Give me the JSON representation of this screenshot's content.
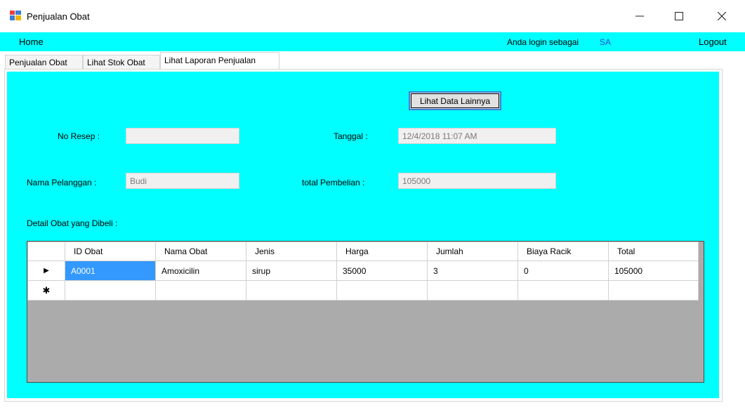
{
  "window": {
    "title": "Penjualan Obat",
    "minimize_icon": "minimize-icon",
    "maximize_icon": "maximize-icon",
    "close_icon": "close-icon"
  },
  "menubar": {
    "home": "Home",
    "login_label": "Anda login sebagai",
    "login_user": "SA",
    "logout": "Logout"
  },
  "tabs": [
    {
      "label": "Penjualan Obat"
    },
    {
      "label": "Lihat Stok Obat"
    },
    {
      "label": "Lihat Laporan Penjualan"
    }
  ],
  "form": {
    "more_button": "Lihat Data Lainnya",
    "no_resep_label": "No Resep :",
    "no_resep_value": "",
    "tanggal_label": "Tanggal :",
    "tanggal_value": "12/4/2018 11:07 AM",
    "nama_pelanggan_label": "Nama Pelanggan :",
    "nama_pelanggan_value": "Budi",
    "total_label": "total Pembelian :",
    "total_value": "105000",
    "detail_label": "Detail Obat yang Dibeli :"
  },
  "grid": {
    "columns": [
      "ID Obat",
      "Nama Obat",
      "Jenis",
      "Harga",
      "Jumlah",
      "Biaya Racik",
      "Total"
    ],
    "rows": [
      [
        "A0001",
        "Amoxicilin",
        "sirup",
        "35000",
        "3",
        "0",
        "105000"
      ]
    ],
    "current_row_glyph": "▶",
    "new_row_glyph": "✱"
  },
  "colors": {
    "panel": "#00ffff",
    "selection": "#3399ff",
    "user_text": "#2a4bd7"
  }
}
